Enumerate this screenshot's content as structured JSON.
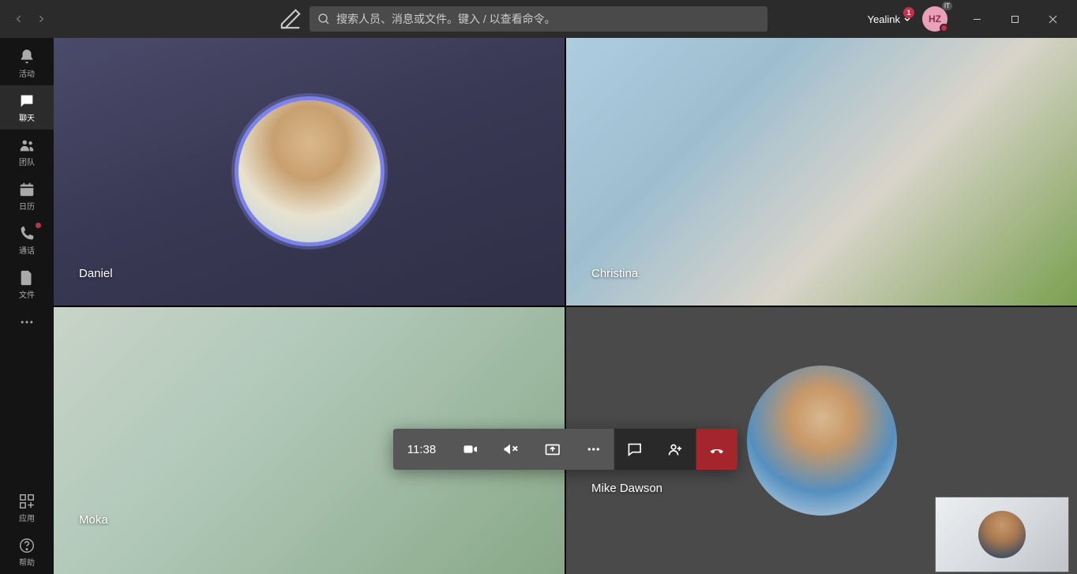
{
  "header": {
    "search_placeholder": "搜索人员、消息或文件。键入 / 以查看命令。",
    "org_name": "Yealink",
    "org_badge": "1",
    "avatar_initials": "HZ",
    "avatar_badge": "IT"
  },
  "rail": {
    "activity": "活动",
    "chat": "聊天",
    "teams": "团队",
    "calendar": "日历",
    "calls": "通话",
    "files": "文件",
    "apps": "应用",
    "help": "帮助"
  },
  "participants": {
    "daniel": "Daniel",
    "christina": "Christina",
    "moka": "Moka",
    "mike": "Mike Dawson"
  },
  "call": {
    "duration": "11:38"
  }
}
